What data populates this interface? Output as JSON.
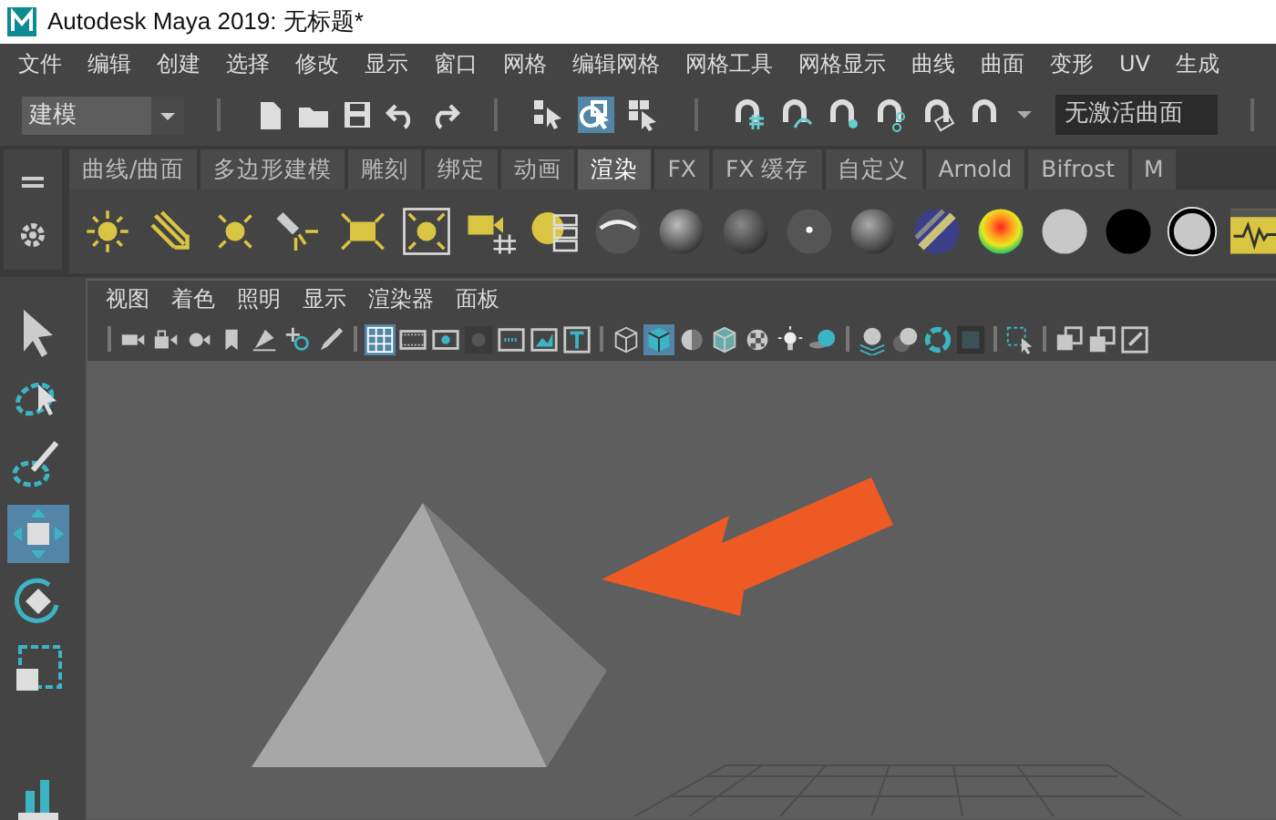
{
  "window": {
    "title": "Autodesk Maya 2019: 无标题*"
  },
  "menu_bar": [
    "文件",
    "编辑",
    "创建",
    "选择",
    "修改",
    "显示",
    "窗口",
    "网格",
    "编辑网格",
    "网格工具",
    "网格显示",
    "曲线",
    "曲面",
    "变形",
    "UV",
    "生成"
  ],
  "toolbar": {
    "mode_dropdown": "建模",
    "select_tools": [
      {
        "selected": false
      },
      {
        "selected": true
      },
      {
        "selected": false
      }
    ],
    "surface_field": "无激活曲面"
  },
  "shelf": {
    "tabs": [
      {
        "label": "曲线/曲面",
        "selected": false
      },
      {
        "label": "多边形建模",
        "selected": false
      },
      {
        "label": "雕刻",
        "selected": false
      },
      {
        "label": "绑定",
        "selected": false
      },
      {
        "label": "动画",
        "selected": false
      },
      {
        "label": "渲染",
        "selected": true
      },
      {
        "label": "FX",
        "selected": false
      },
      {
        "label": "FX 缓存",
        "selected": false
      },
      {
        "label": "自定义",
        "selected": false
      },
      {
        "label": "Arnold",
        "selected": false
      },
      {
        "label": "Bifrost",
        "selected": false
      },
      {
        "label": "M",
        "selected": false
      }
    ]
  },
  "toolbox": {
    "tools": [
      {
        "selected": false
      },
      {
        "selected": false
      },
      {
        "selected": false
      },
      {
        "selected": true
      },
      {
        "selected": false
      },
      {
        "selected": false
      }
    ]
  },
  "viewport": {
    "menu": [
      "视图",
      "着色",
      "照明",
      "显示",
      "渲染器",
      "面板"
    ],
    "toolbar_tools": [
      {
        "selected": false
      },
      {
        "selected": false
      },
      {
        "selected": false
      },
      {
        "selected": false
      },
      {
        "selected": false
      },
      {
        "selected": false
      },
      {
        "selected": false
      },
      {
        "selected": true
      },
      {
        "selected": false
      },
      {
        "selected": false
      },
      {
        "selected": false
      },
      {
        "selected": false
      },
      {
        "selected": false
      },
      {
        "selected": false
      },
      {
        "selected": false
      },
      {
        "selected": true
      },
      {
        "selected": false
      },
      {
        "selected": false
      },
      {
        "selected": false
      },
      {
        "selected": false
      },
      {
        "selected": false
      },
      {
        "selected": false
      },
      {
        "selected": false
      },
      {
        "selected": false
      },
      {
        "selected": false
      },
      {
        "selected": false
      },
      {
        "selected": false
      },
      {
        "selected": false
      },
      {
        "selected": false
      }
    ]
  }
}
